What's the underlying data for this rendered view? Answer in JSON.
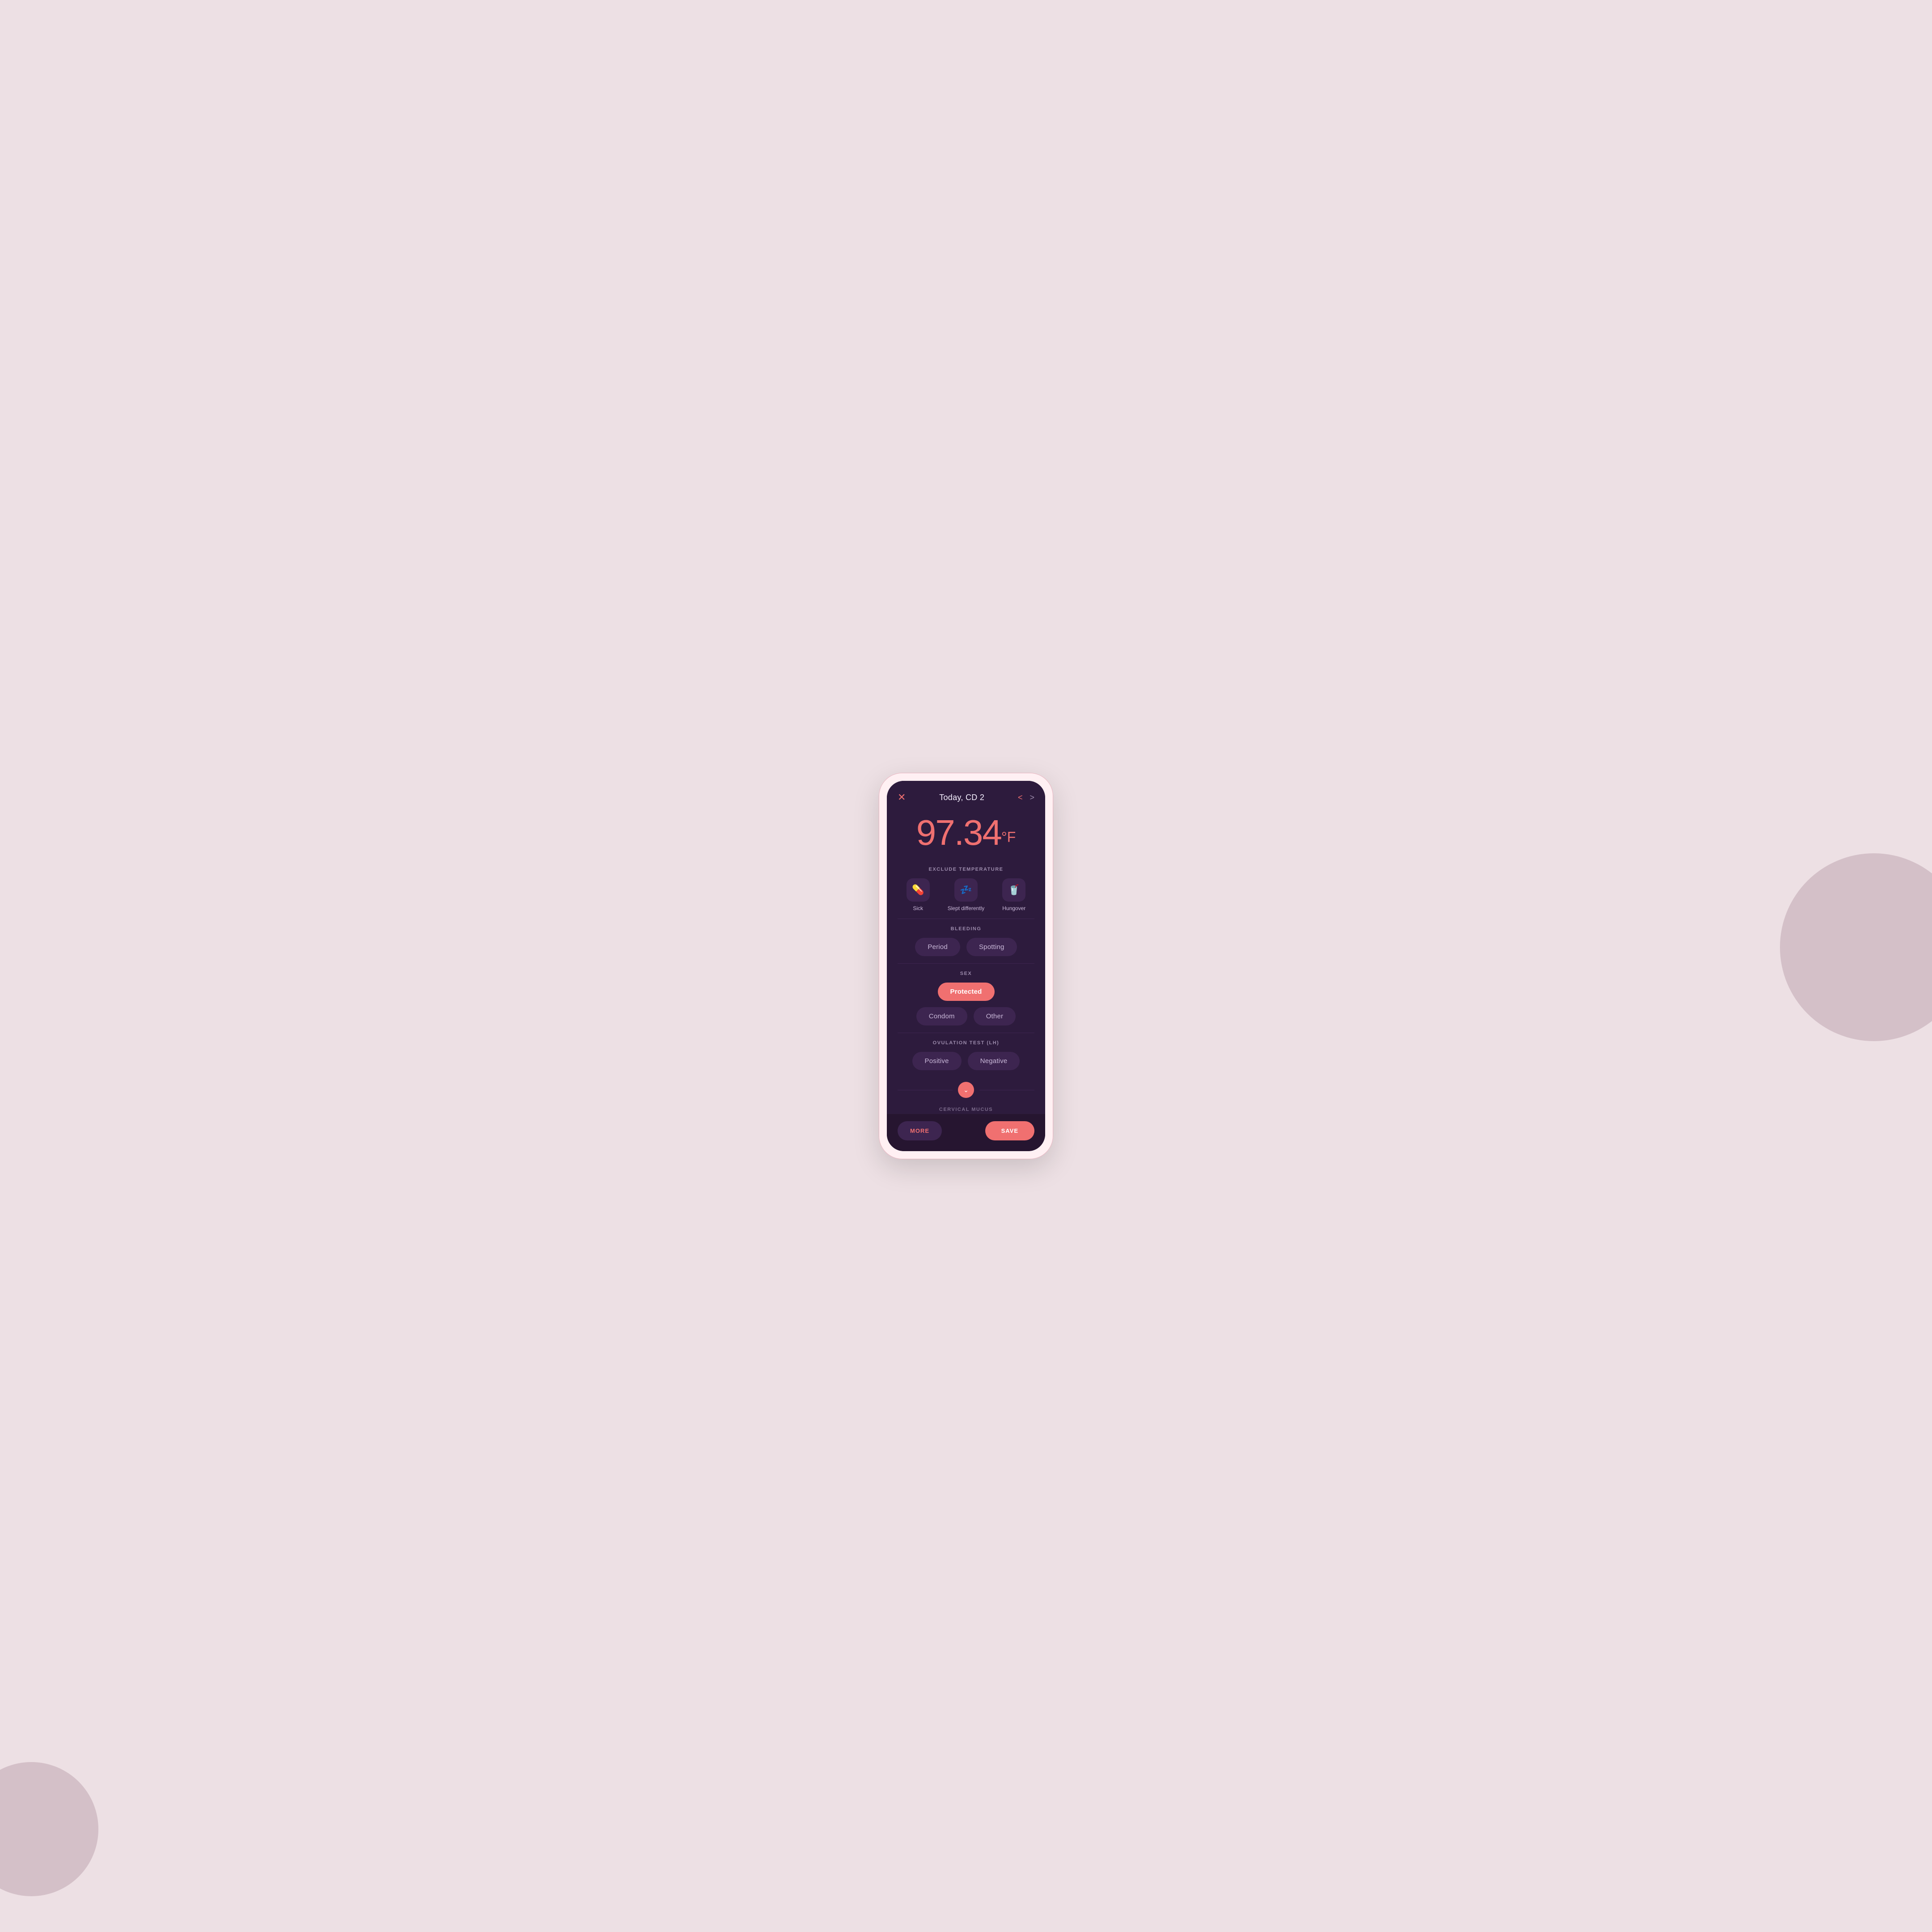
{
  "background": {
    "color": "#ede0e4",
    "circle_right_color": "#d4c0c8",
    "circle_left_color": "#d4c0c8"
  },
  "header": {
    "close_icon": "✕",
    "title": "Today, CD 2",
    "nav_back": "<",
    "nav_forward": ">"
  },
  "temperature": {
    "value": "97.34",
    "unit": "°F"
  },
  "exclude_temperature": {
    "label": "EXCLUDE TEMPERATURE",
    "options": [
      {
        "id": "sick",
        "icon": "💊",
        "label": "Sick"
      },
      {
        "id": "slept-differently",
        "icon": "💤",
        "label": "Slept differently"
      },
      {
        "id": "hungover",
        "icon": "🥤",
        "label": "Hungover"
      }
    ]
  },
  "bleeding": {
    "label": "BLEEDING",
    "options": [
      {
        "id": "period",
        "label": "Period",
        "active": false
      },
      {
        "id": "spotting",
        "label": "Spotting",
        "active": false
      }
    ]
  },
  "sex": {
    "label": "SEX",
    "primary_options": [
      {
        "id": "protected",
        "label": "Protected",
        "active": true
      }
    ],
    "secondary_options": [
      {
        "id": "condom",
        "label": "Condom",
        "active": false
      },
      {
        "id": "other",
        "label": "Other",
        "active": false
      }
    ]
  },
  "ovulation_test": {
    "label": "OVULATION TEST (LH)",
    "options": [
      {
        "id": "positive",
        "label": "Positive",
        "active": false
      },
      {
        "id": "negative",
        "label": "Negative",
        "active": false
      }
    ]
  },
  "expand": {
    "icon": "⌄"
  },
  "cervical_mucus": {
    "label": "CERVICAL MUCUS"
  },
  "bottom_bar": {
    "more_label": "MORE",
    "save_label": "SAVE"
  }
}
